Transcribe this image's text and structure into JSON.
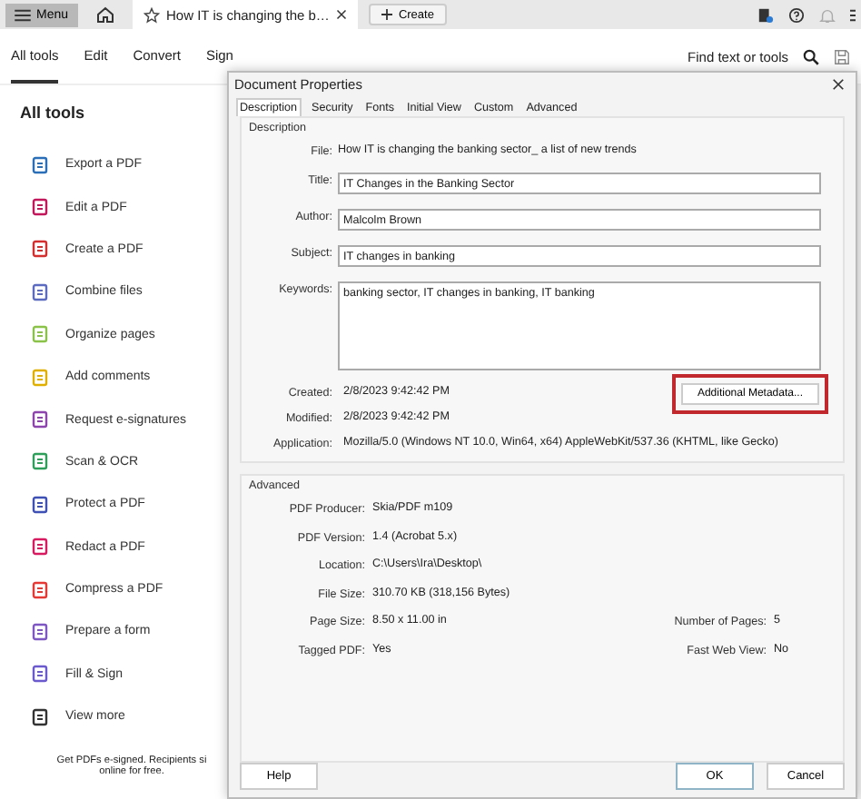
{
  "topbar": {
    "menu": "Menu",
    "tab_title": "How IT is changing the b…",
    "create": "Create"
  },
  "nav": {
    "tabs": [
      {
        "label": "All tools",
        "selected": true
      },
      {
        "label": "Edit",
        "selected": false
      },
      {
        "label": "Convert",
        "selected": false
      },
      {
        "label": "Sign",
        "selected": false
      }
    ],
    "search": "Find text or tools"
  },
  "sidebar": {
    "heading": "All tools",
    "tools": [
      {
        "label": "Export a PDF",
        "color": "#2a6fb8"
      },
      {
        "label": "Edit a PDF",
        "color": "#c2185b"
      },
      {
        "label": "Create a PDF",
        "color": "#d32f2f"
      },
      {
        "label": "Combine files",
        "color": "#5c6bc0"
      },
      {
        "label": "Organize pages",
        "color": "#8bc34a"
      },
      {
        "label": "Add comments",
        "color": "#e0b000"
      },
      {
        "label": "Request e-signatures",
        "color": "#8e44ad"
      },
      {
        "label": "Scan & OCR",
        "color": "#2e9e5b"
      },
      {
        "label": "Protect a PDF",
        "color": "#3f51b5"
      },
      {
        "label": "Redact a PDF",
        "color": "#d81b60"
      },
      {
        "label": "Compress a PDF",
        "color": "#e53935"
      },
      {
        "label": "Prepare a form",
        "color": "#7e57c2"
      },
      {
        "label": "Fill & Sign",
        "color": "#6a5acd"
      },
      {
        "label": "View more",
        "color": "#333333"
      }
    ],
    "promo": [
      "Get PDFs e-signed. Recipients si",
      "online for free."
    ]
  },
  "dialog": {
    "title": "Document Properties",
    "tabs": [
      {
        "label": "Description",
        "selected": true
      },
      {
        "label": "Security",
        "selected": false
      },
      {
        "label": "Fonts",
        "selected": false
      },
      {
        "label": "Initial View",
        "selected": false
      },
      {
        "label": "Custom",
        "selected": false
      },
      {
        "label": "Advanced",
        "selected": false
      }
    ],
    "description": {
      "heading": "Description",
      "file": {
        "label": "File:",
        "value": "How IT is changing the banking sector_ a list of new trends"
      },
      "fields": [
        {
          "label": "Title:",
          "value": "IT Changes in the Banking Sector",
          "kind": "line"
        },
        {
          "label": "Author:",
          "value": "Malcolm Brown",
          "kind": "line"
        },
        {
          "label": "Subject:",
          "value": "IT changes in banking",
          "kind": "line"
        },
        {
          "label": "Keywords:",
          "value": "banking sector, IT changes in banking, IT banking",
          "kind": "area"
        }
      ],
      "info": [
        {
          "label": "Created:",
          "value": "2/8/2023 9:42:42 PM"
        },
        {
          "label": "Modified:",
          "value": "2/8/2023 9:42:42 PM"
        },
        {
          "label": "Application:",
          "value": "Mozilla/5.0 (Windows NT 10.0, Win64, x64) AppleWebKit/537.36 (KHTML, like Gecko)"
        }
      ],
      "metadata_button": "Additional Metadata..."
    },
    "advanced": {
      "heading": "Advanced",
      "rows": [
        {
          "label": "PDF Producer:",
          "value": "Skia/PDF m109"
        },
        {
          "label": "PDF Version:",
          "value": "1.4 (Acrobat 5.x)"
        },
        {
          "label": "Location:",
          "value": "C:\\Users\\Ira\\Desktop\\"
        },
        {
          "label": "File Size:",
          "value": "310.70 KB (318,156 Bytes)"
        },
        {
          "label": "Page Size:",
          "value": "8.50 x 11.00 in",
          "label_2": "Number of Pages:",
          "value_2": "5"
        },
        {
          "label": "Tagged PDF:",
          "value": "Yes",
          "label_2": "Fast Web View:",
          "value_2": "No"
        }
      ]
    },
    "buttons": {
      "help": "Help",
      "ok": "OK",
      "cancel": "Cancel"
    }
  }
}
